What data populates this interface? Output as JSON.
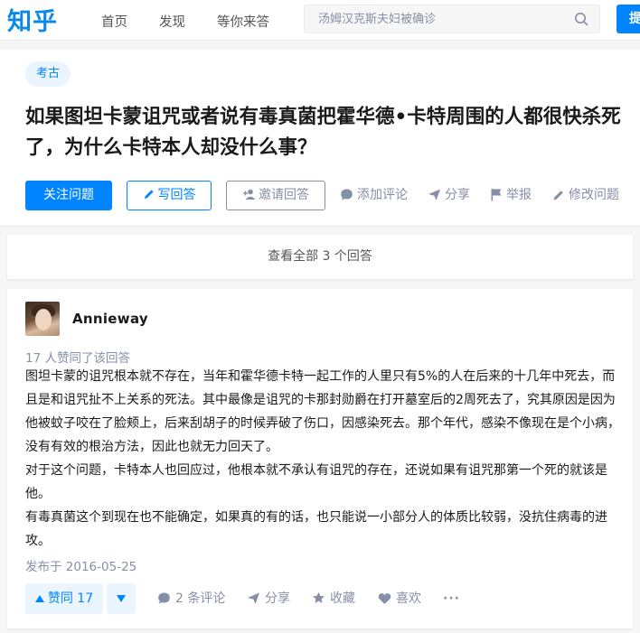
{
  "topbar": {
    "logo": "知乎",
    "nav": [
      "首页",
      "发现",
      "等你来答"
    ],
    "search_placeholder": "汤姆汉克斯夫妇被确诊",
    "ask_button": "提问"
  },
  "question": {
    "tag": "考古",
    "title": "如果图坦卡蒙诅咒或者说有毒真菌把霍华德•卡特周围的人都很快杀死了，为什么卡特本人却没什么事？",
    "buttons": {
      "follow": "关注问题",
      "write": "写回答",
      "invite": "邀请回答"
    },
    "actions": {
      "comment": "添加评论",
      "share": "分享",
      "report": "举报",
      "edit": "修改问题"
    }
  },
  "view_all": "查看全部 3 个回答",
  "answer": {
    "author": "Annieway",
    "votes_text": "17 人赞同了该回答",
    "paragraphs": [
      "图坦卡蒙的诅咒根本就不存在，当年和霍华德卡特一起工作的人里只有5%的人在后来的十几年中死去，而且是和诅咒扯不上关系的死法。其中最像是诅咒的卡那封勋爵在打开墓室后的2周死去了，究其原因是因为他被蚊子咬在了脸颊上，后来刮胡子的时候弄破了伤口，因感染死去。那个年代，感染不像现在是个小病，没有有效的根治方法，因此也就无力回天了。",
      "对于这个问题，卡特本人也回应过，他根本就不承认有诅咒的存在，还说如果有诅咒那第一个死的就该是他。",
      "有毒真菌这个到现在也不能确定，如果真的有的话，也只能说一小部分人的体质比较弱，没抗住病毒的进攻。"
    ],
    "published": "发布于 2016-05-25",
    "upvote_label": "赞同 17",
    "actions": {
      "comments": "2 条评论",
      "share": "分享",
      "collect": "收藏",
      "like": "喜欢",
      "more": "···"
    }
  },
  "colors": {
    "brand": "#0084ff",
    "muted": "#8590a6",
    "background": "#f6f6f6"
  }
}
